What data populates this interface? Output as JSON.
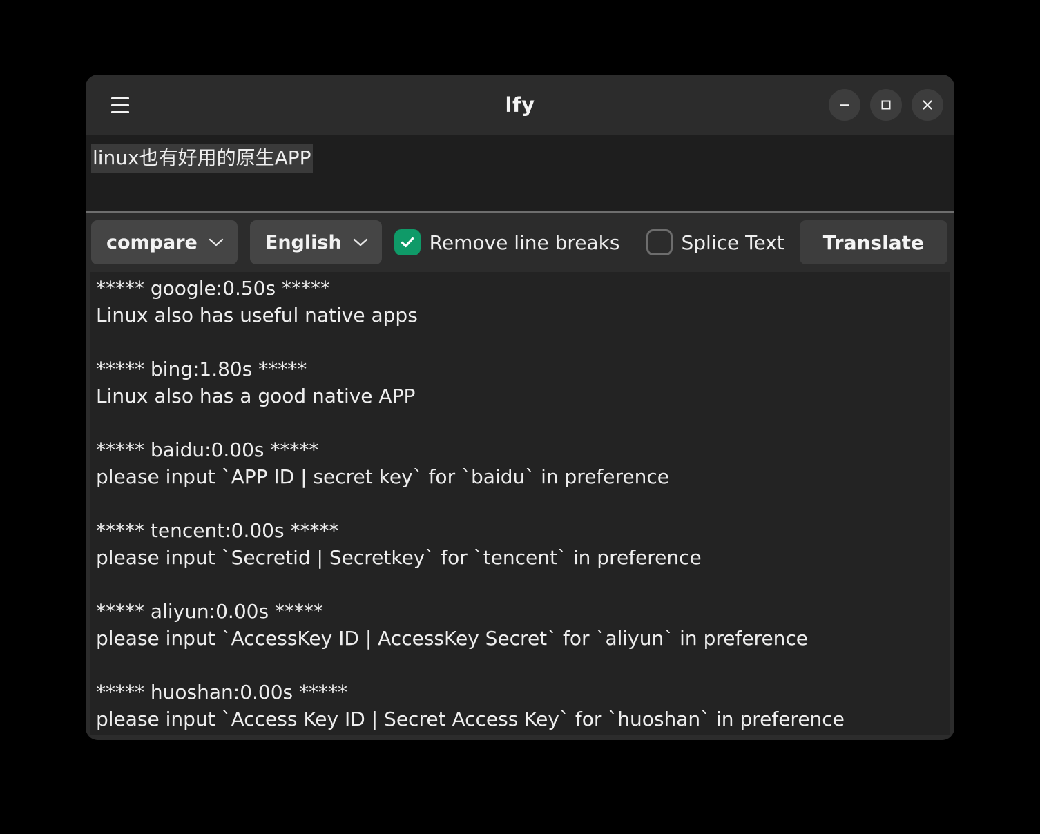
{
  "window": {
    "title": "lfy",
    "menu_icon": "hamburger-menu-icon",
    "controls": {
      "minimize": "minimize-icon",
      "maximize": "maximize-icon",
      "close": "close-icon"
    }
  },
  "input": {
    "value": "linux也有好用的原生APP",
    "placeholder": ""
  },
  "toolbar": {
    "engine_dropdown": {
      "value": "compare",
      "icon": "chevron-down-icon"
    },
    "language_dropdown": {
      "value": "English",
      "icon": "chevron-down-icon"
    },
    "remove_line_breaks": {
      "label": "Remove line breaks",
      "checked": true
    },
    "splice_text": {
      "label": "Splice Text",
      "checked": false
    },
    "translate_button": "Translate"
  },
  "result": {
    "lines": [
      "***** google:0.50s *****",
      "Linux also has useful native apps",
      "",
      "***** bing:1.80s *****",
      "Linux also has a good native APP",
      "",
      "***** baidu:0.00s *****",
      "please input `APP ID | secret key` for `baidu` in preference",
      "",
      "***** tencent:0.00s *****",
      "please input `Secretid | Secretkey` for `tencent` in preference",
      "",
      "***** aliyun:0.00s *****",
      "please input `AccessKey ID | AccessKey Secret` for `aliyun` in preference",
      "",
      "***** huoshan:0.00s *****",
      "please input `Access Key ID | Secret Access Key` for `huoshan` in preference"
    ]
  },
  "colors": {
    "desktop": "#000000",
    "window_bg": "#2c2c2c",
    "input_bg": "#1e1e1e",
    "result_bg": "#232323",
    "control_bg": "#3d3d3d",
    "dropdown_bg": "#454545",
    "checkbox_on": "#0f9a68",
    "checkbox_border": "#6d6d6d",
    "divider": "#6e6e6e",
    "text": "#eeeeee"
  }
}
